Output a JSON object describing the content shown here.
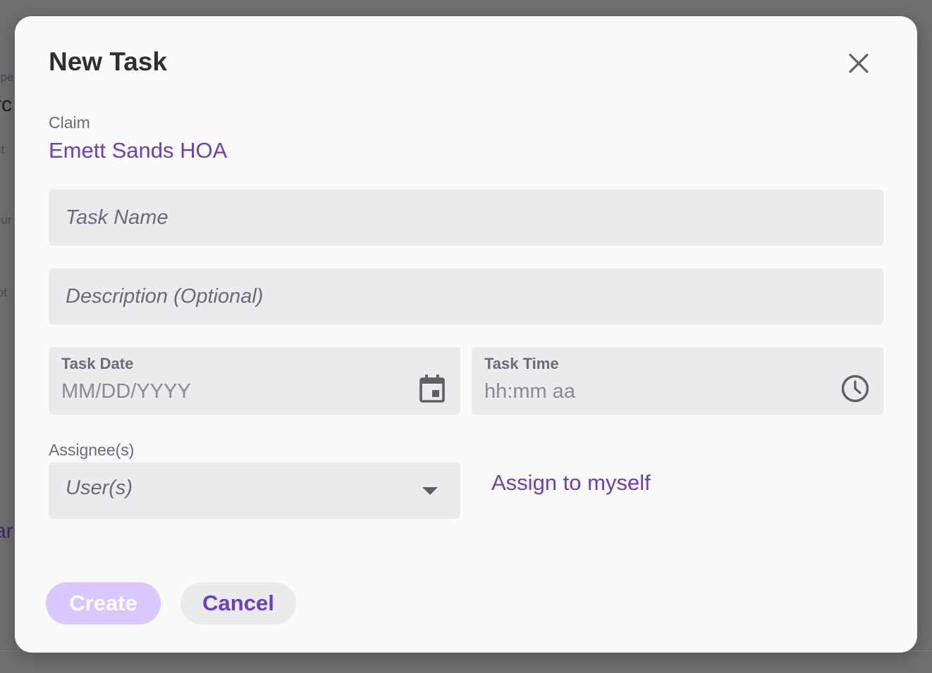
{
  "background": {
    "fragments": [
      "ype",
      "rc",
      "nt",
      "our",
      "ipt",
      ",",
      "ar"
    ]
  },
  "modal": {
    "title": "New Task",
    "claim": {
      "label": "Claim",
      "value": "Emett Sands HOA"
    },
    "task_name": {
      "placeholder": "Task Name",
      "value": ""
    },
    "description": {
      "placeholder": "Description (Optional)",
      "value": ""
    },
    "task_date": {
      "label": "Task Date",
      "placeholder": "MM/DD/YYYY",
      "value": ""
    },
    "task_time": {
      "label": "Task Time",
      "placeholder": "hh:mm aa",
      "value": ""
    },
    "assignees": {
      "label": "Assignee(s)",
      "placeholder": "User(s)"
    },
    "assign_to_myself": "Assign to myself",
    "buttons": {
      "create": "Create",
      "cancel": "Cancel"
    }
  },
  "colors": {
    "accent": "#6a3fc0",
    "create_disabled": "#d9c7ff",
    "field_bg": "#ebebee"
  },
  "icons": {
    "close": "close-icon",
    "calendar": "calendar-icon",
    "clock": "clock-icon",
    "dropdown": "caret-down-icon"
  }
}
